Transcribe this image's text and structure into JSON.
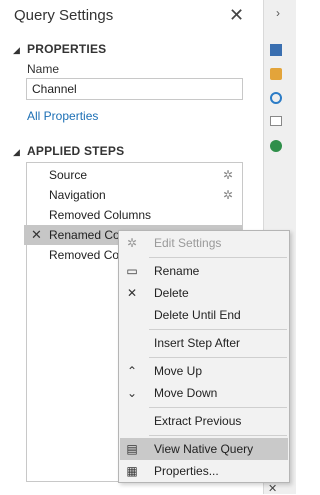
{
  "pane": {
    "title": "Query Settings",
    "properties_header": "PROPERTIES",
    "name_label": "Name",
    "name_value": "Channel",
    "all_properties_link": "All Properties",
    "applied_steps_header": "APPLIED STEPS"
  },
  "steps": [
    {
      "label": "Source",
      "has_gear": true
    },
    {
      "label": "Navigation",
      "has_gear": true
    },
    {
      "label": "Removed Columns",
      "has_gear": false
    },
    {
      "label": "Renamed Co",
      "has_gear": false,
      "selected": true
    },
    {
      "label": "Removed Co",
      "has_gear": false
    }
  ],
  "context_menu": {
    "items": [
      {
        "label": "Edit Settings",
        "icon": "gear-icon",
        "disabled": true
      },
      {
        "label": "Rename",
        "icon": "rename-icon"
      },
      {
        "label": "Delete",
        "icon": "close-icon"
      },
      {
        "label": "Delete Until End",
        "icon": ""
      },
      {
        "label": "Insert Step After",
        "icon": ""
      },
      {
        "label": "Move Up",
        "icon": "chevron-up-icon"
      },
      {
        "label": "Move Down",
        "icon": "chevron-down-icon"
      },
      {
        "label": "Extract Previous",
        "icon": ""
      },
      {
        "label": "View Native Query",
        "icon": "native-query-icon",
        "highlighted": true
      },
      {
        "label": "Properties...",
        "icon": "properties-icon"
      }
    ]
  },
  "icons": {
    "gear": "✲",
    "close": "✕",
    "arrow_collapse": "◢"
  },
  "colors": {
    "link": "#1c6fb5",
    "selected_step": "#c6c6c6",
    "menu_highlight": "#c9c9c9"
  }
}
